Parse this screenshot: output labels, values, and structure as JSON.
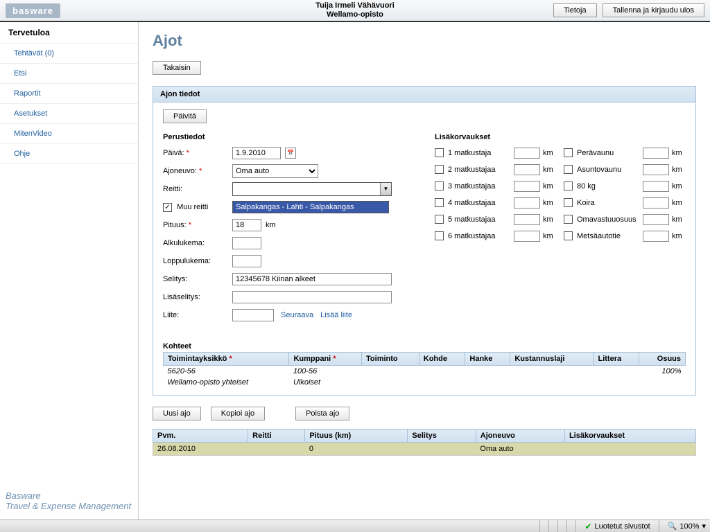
{
  "header": {
    "logo": "basware",
    "user": "Tuija Irmeli Vähävuori",
    "org": "Wellamo-opisto",
    "info_btn": "Tietoja",
    "logout_btn": "Tallenna ja kirjaudu ulos"
  },
  "sidebar": {
    "title": "Tervetuloa",
    "items": [
      "Tehtävät (0)",
      "Etsi",
      "Raportit",
      "Asetukset",
      "MitenVideo",
      "Ohje"
    ],
    "footer_line1": "Basware",
    "footer_line2": "Travel & Expense Management"
  },
  "page": {
    "title": "Ajot",
    "back_btn": "Takaisin"
  },
  "panel": {
    "title": "Ajon tiedot",
    "update_btn": "Päivitä",
    "basics_title": "Perustiedot",
    "comp_title": "Lisäkorvaukset",
    "labels": {
      "paiva": "Päivä:",
      "ajoneuvo": "Ajoneuvo:",
      "reitti": "Reitti:",
      "muu_reitti": "Muu reitti",
      "pituus": "Pituus:",
      "alkulukema": "Alkulukema:",
      "loppulukema": "Loppulukema:",
      "selitys": "Selitys:",
      "lisaselitys": "Lisäselitys:",
      "liite": "Liite:"
    },
    "values": {
      "paiva": "1.9.2010",
      "ajoneuvo": "Oma auto",
      "muu_reitti": "Salpakangas - Lahti - Salpakangas",
      "pituus": "18",
      "km": "km",
      "selitys": "12345678 Kiinan alkeet"
    },
    "links": {
      "seuraava": "Seuraava",
      "lisaa_liite": "Lisää liite"
    },
    "comp_left": [
      "1 matkustaja",
      "2 matkustajaa",
      "3 matkustajaa",
      "4 matkustajaa",
      "5 matkustajaa",
      "6 matkustajaa"
    ],
    "comp_right": [
      "Perävaunu",
      "Asuntovaunu",
      "80 kg",
      "Koira",
      "Omavastuuosuus",
      "Metsäautotie"
    ],
    "km_unit": "km"
  },
  "kohteet": {
    "title": "Kohteet",
    "headers": [
      "Toimintayksikkö *",
      "Kumppani *",
      "Toiminto",
      "Kohde",
      "Hanke",
      "Kustannuslaji",
      "Littera",
      "Osuus"
    ],
    "row1": [
      "5620-56",
      "100-56",
      "",
      "",
      "",
      "",
      "",
      "100%"
    ],
    "row2": [
      "Wellamo-opisto yhteiset",
      "Ulkoiset",
      "",
      "",
      "",
      "",
      "",
      ""
    ]
  },
  "actions": {
    "uusi": "Uusi ajo",
    "kopioi": "Kopioi ajo",
    "poista": "Poista ajo"
  },
  "ajot_table": {
    "headers": [
      "Pvm.",
      "Reitti",
      "Pituus (km)",
      "Selitys",
      "Ajoneuvo",
      "Lisäkorvaukset"
    ],
    "row": [
      "26.08.2010",
      "",
      "0",
      "",
      "Oma auto",
      ""
    ]
  },
  "status": {
    "trusted": "Luotetut sivustot",
    "zoom": "100%"
  }
}
